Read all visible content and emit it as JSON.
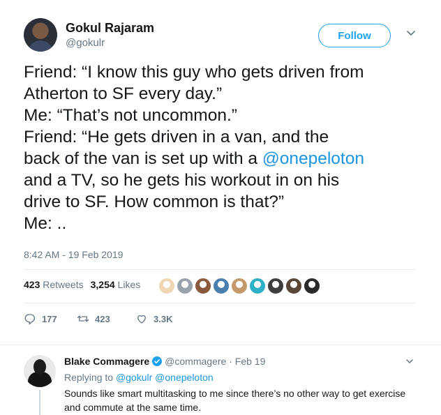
{
  "tweet": {
    "author": {
      "name": "Gokul Rajaram",
      "handle": "@gokulr"
    },
    "follow_label": "Follow",
    "body": {
      "line1": "Friend: “I know this guy who gets driven from",
      "line2": "Atherton to SF every day.”",
      "line3": "Me: “That’s not uncommon.”",
      "line4": "Friend: “He gets driven in a van, and the",
      "line5_pre": "back of the van is set up with a ",
      "line5_mention": "@onepeloton",
      "line6": "and a TV, so he gets his workout in on his",
      "line7": "drive to SF. How common is that?”",
      "line8": "Me: .."
    },
    "timestamp": "8:42 AM - 19 Feb 2019",
    "stats": {
      "retweets_count": "423",
      "retweets_label": "Retweets",
      "likes_count": "3,254",
      "likes_label": "Likes"
    },
    "likers": [
      {
        "color": "#f0d7b4"
      },
      {
        "color": "#9aa3ad"
      },
      {
        "color": "#8a5a3c"
      },
      {
        "color": "#4a7fb0"
      },
      {
        "color": "#c49a6c"
      },
      {
        "color": "#2fb0c9"
      },
      {
        "color": "#3d3d3d"
      },
      {
        "color": "#5a4636"
      },
      {
        "color": "#2a2a2a"
      }
    ],
    "actions": {
      "replies": "177",
      "retweets": "423",
      "likes": "3.3K"
    }
  },
  "reply": {
    "name": "Blake Commagere",
    "handle": "@commagere",
    "dot": "·",
    "date": "Feb 19",
    "replying_to_label": "Replying to",
    "replying_to_users": "@gokulr @onepeloton",
    "text_line1": "Sounds like smart multitasking to me since there’s no other way to get exercise",
    "text_line2": "and commute at the same time."
  },
  "colors": {
    "accent": "#1da1f2",
    "mention": "#1b95e0",
    "muted": "#657786",
    "border": "#e6ecf0",
    "verified": "#1da1f2"
  },
  "icons": [
    "chevron-down-icon",
    "reply-icon",
    "retweet-icon",
    "like-icon",
    "verified-icon"
  ]
}
